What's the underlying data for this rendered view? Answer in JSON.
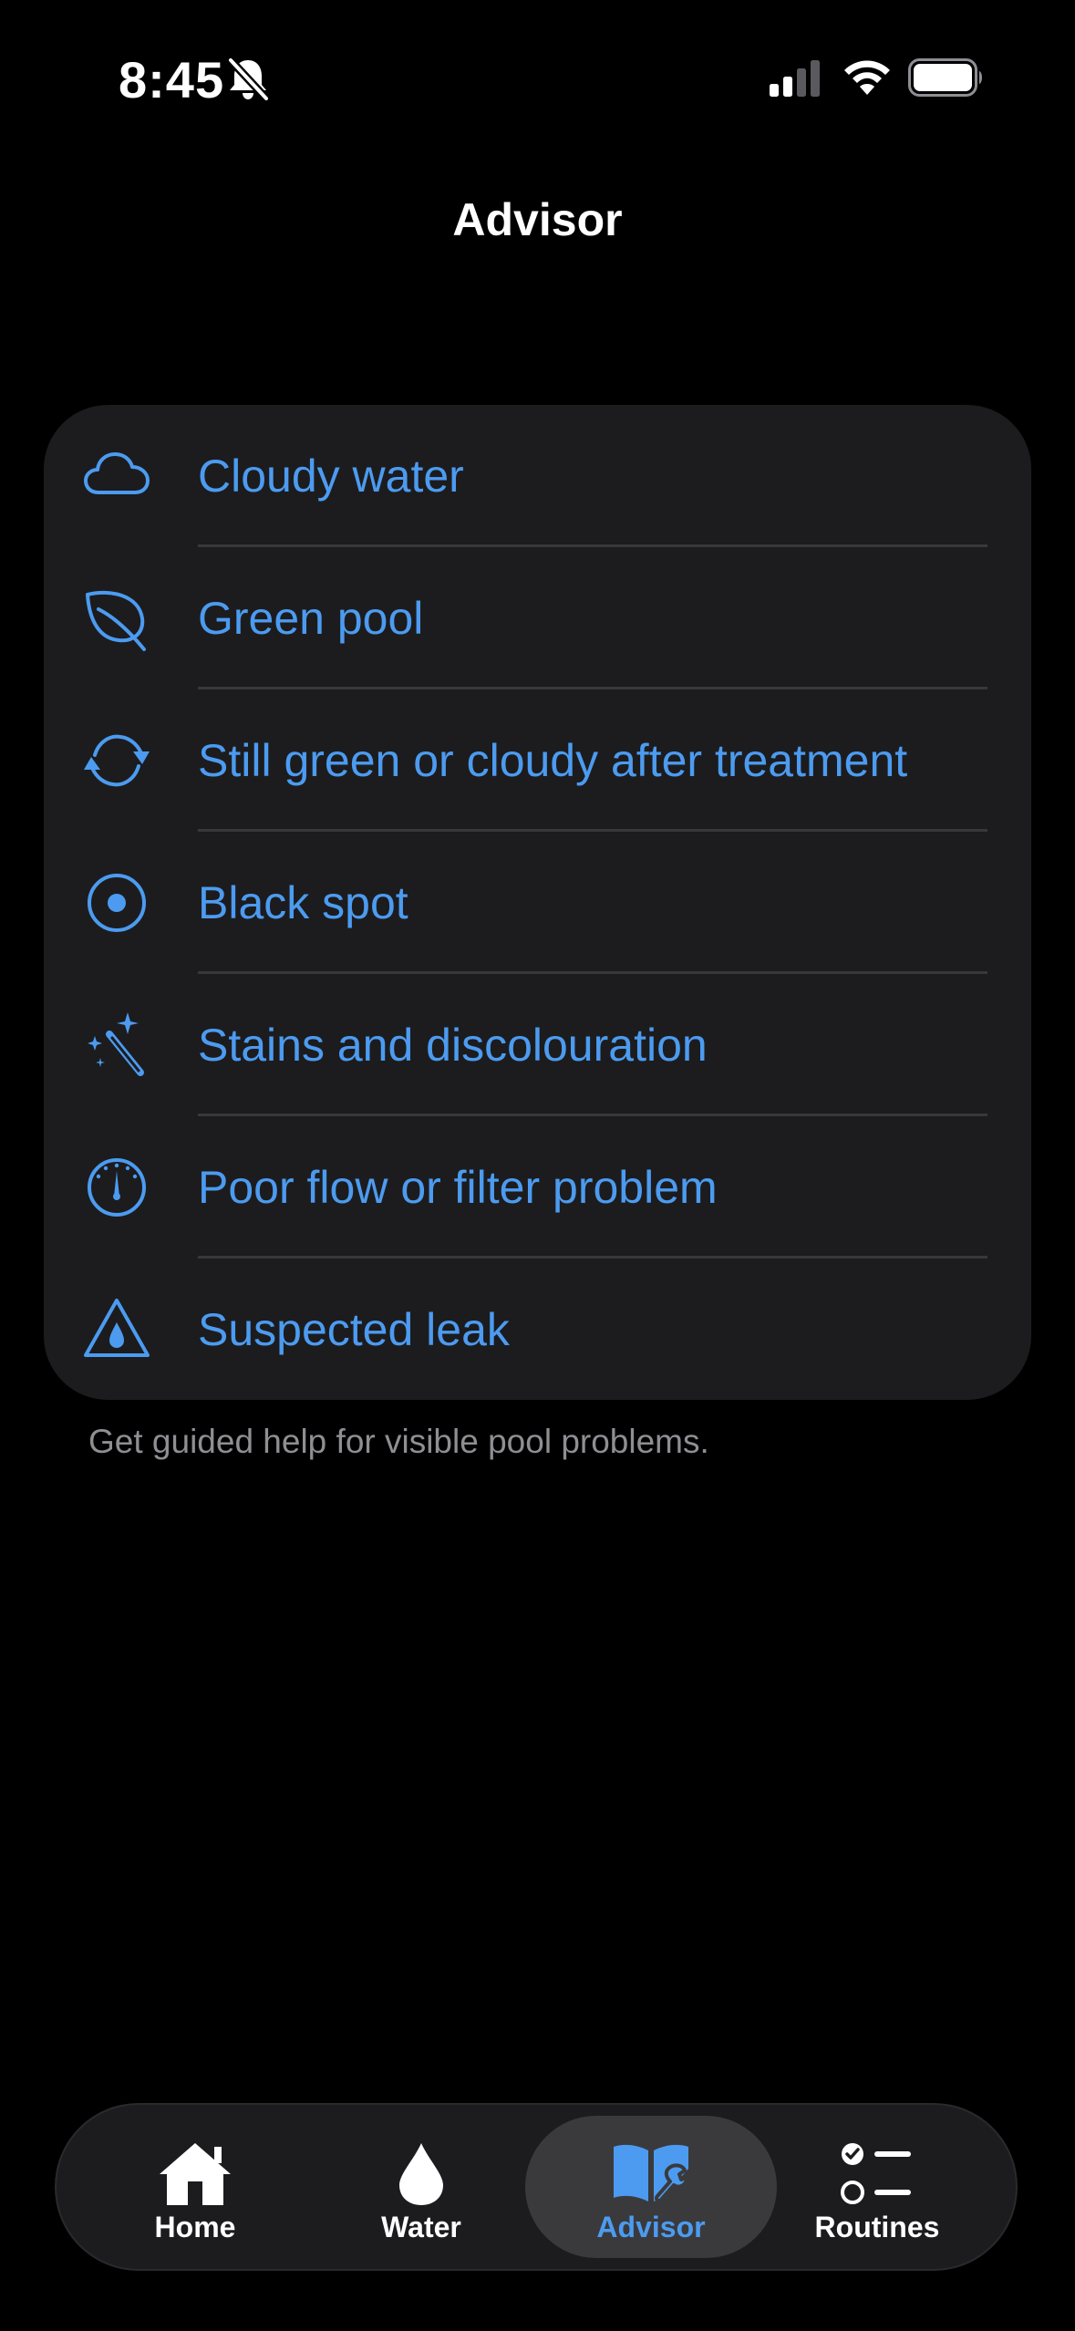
{
  "status_bar": {
    "time": "8:45",
    "icons": [
      "bell-slash-icon",
      "cellular-signal-icon",
      "wifi-icon",
      "battery-icon"
    ]
  },
  "header": {
    "title": "Advisor"
  },
  "problems": [
    {
      "label": "Cloudy water",
      "icon": "cloud-icon"
    },
    {
      "label": "Green pool",
      "icon": "leaf-icon"
    },
    {
      "label": "Still green or cloudy after treatment",
      "icon": "refresh-icon"
    },
    {
      "label": "Black spot",
      "icon": "target-dot-icon"
    },
    {
      "label": "Stains and discolouration",
      "icon": "magic-wand-icon"
    },
    {
      "label": "Poor flow or filter problem",
      "icon": "gauge-icon"
    },
    {
      "label": "Suspected leak",
      "icon": "warning-drop-icon"
    }
  ],
  "footer": {
    "text": "Get guided help for visible pool problems."
  },
  "tab_bar": {
    "tabs": [
      {
        "label": "Home",
        "icon": "house-icon",
        "active": false
      },
      {
        "label": "Water",
        "icon": "drop-icon",
        "active": false
      },
      {
        "label": "Advisor",
        "icon": "book-wrench-icon",
        "active": true
      },
      {
        "label": "Routines",
        "icon": "checklist-icon",
        "active": false
      }
    ]
  },
  "colors": {
    "background": "#000000",
    "card": "#1c1c1e",
    "accent": "#4c9bf0",
    "secondary_text": "#8e8e93",
    "divider": "#38383a"
  }
}
